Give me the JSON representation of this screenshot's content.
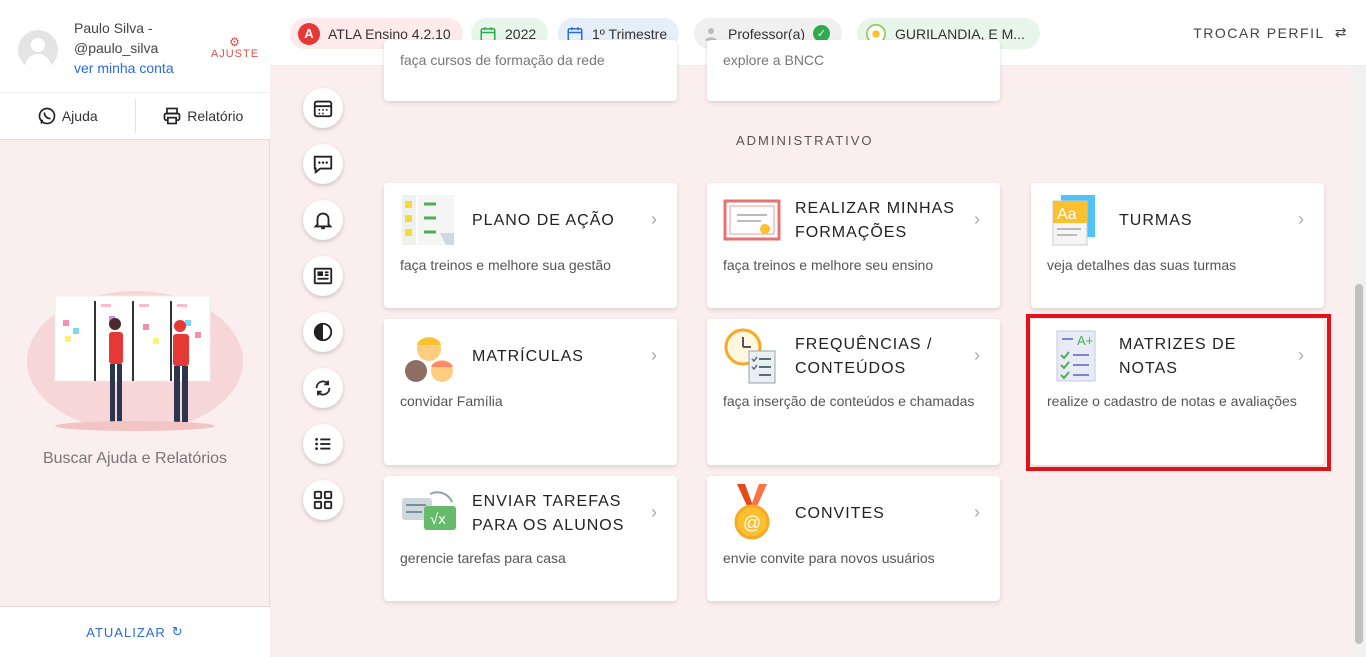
{
  "sidebar": {
    "user_name": "Paulo Silva - @paulo_silva",
    "account_link": "ver minha conta",
    "ajuste_label": "AJUSTE",
    "help_label": "Ajuda",
    "report_label": "Relatório",
    "help_text": "Buscar Ajuda e Relatórios",
    "refresh_label": "ATUALIZAR"
  },
  "topbar": {
    "app_version": "ATLA Ensino 4.2.10",
    "year": "2022",
    "term": "1º Trimestre",
    "role": "Professor(a)",
    "school": "GURILANDIA, E M...",
    "switch_profile": "TROCAR PERFIL"
  },
  "top_cards": {
    "left_desc": "faça cursos de formação da rede",
    "middle_desc": "explore a BNCC"
  },
  "section_title": "ADMINISTRATIVO",
  "cards": [
    {
      "title": "PLANO DE AÇÃO",
      "desc": "faça treinos e melhore sua gestão",
      "icon": "checklist-icon"
    },
    {
      "title": "REALIZAR MINHAS FORMAÇÕES",
      "desc": "faça treinos e melhore seu ensino",
      "icon": "certificate-icon"
    },
    {
      "title": "TURMAS",
      "desc": "veja detalhes das suas turmas",
      "icon": "font-book-icon"
    },
    {
      "title": "MATRÍCULAS",
      "desc": "convidar Família",
      "icon": "children-icon"
    },
    {
      "title": "FREQUÊNCIAS / CONTEÚDOS",
      "desc": "faça inserção de conteúdos e chamadas",
      "icon": "clock-list-icon"
    },
    {
      "title": "MATRIZES DE NOTAS",
      "desc": "realize o cadastro de notas e avaliações",
      "icon": "grade-sheet-icon"
    },
    {
      "title": "ENVIAR TAREFAS PARA OS ALUNOS",
      "desc": "gerencie tarefas para casa",
      "icon": "homework-icon"
    },
    {
      "title": "CONVITES",
      "desc": "envie convite para novos usuários",
      "icon": "medal-invite-icon"
    }
  ],
  "side_icons": [
    "calendar-icon",
    "chat-icon",
    "bell-icon",
    "newspaper-icon",
    "contrast-icon",
    "sync-icon",
    "list-icon",
    "grid-icon"
  ],
  "colors": {
    "accent": "#2b6cd9",
    "brand": "#e53935",
    "highlight": "#e0131a",
    "background": "#fbeeee"
  }
}
